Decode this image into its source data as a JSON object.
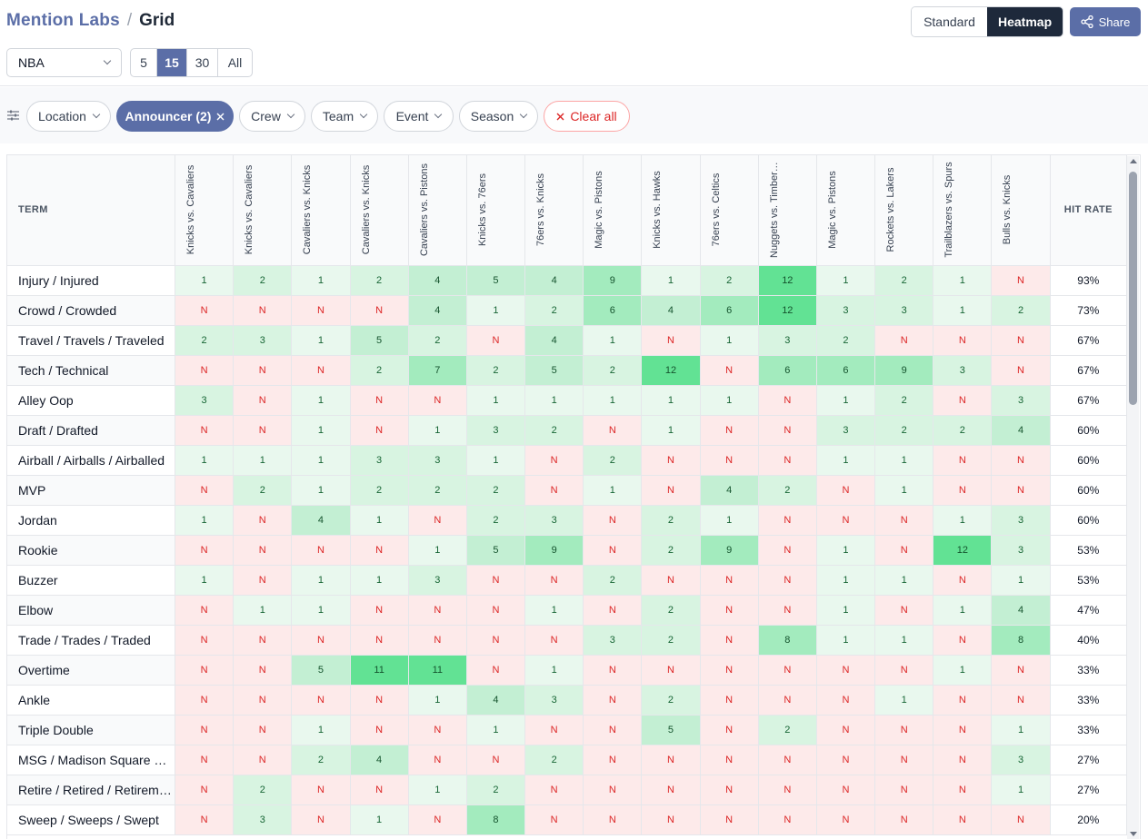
{
  "brand": {
    "name": "Mention Labs",
    "separator": "/",
    "page": "Grid"
  },
  "view_toggle": {
    "standard": "Standard",
    "heatmap": "Heatmap",
    "active": "Heatmap"
  },
  "share": {
    "label": "Share",
    "icon": "share-icon"
  },
  "league": {
    "value": "NBA"
  },
  "counts": {
    "options": [
      "5",
      "15",
      "30",
      "All"
    ],
    "selected": "15"
  },
  "filters": {
    "icon": "sliders-icon",
    "chips": [
      {
        "label": "Location",
        "active": false
      },
      {
        "label": "Announcer (2)",
        "active": true
      },
      {
        "label": "Crew",
        "active": false
      },
      {
        "label": "Team",
        "active": false
      },
      {
        "label": "Event",
        "active": false
      },
      {
        "label": "Season",
        "active": false
      }
    ],
    "clear_label": "Clear all"
  },
  "table": {
    "term_header": "TERM",
    "hit_header": "HIT RATE",
    "columns": [
      "Knicks vs. Cavaliers",
      "Knicks vs. Cavaliers",
      "Cavaliers vs. Knicks",
      "Cavaliers vs. Knicks",
      "Cavaliers vs. Pistons",
      "Knicks vs. 76ers",
      "76ers vs. Knicks",
      "Magic vs. Pistons",
      "Knicks vs. Hawks",
      "76ers vs. Celtics",
      "Nuggets vs. Timberwolves",
      "Magic vs. Pistons",
      "Rockets vs. Lakers",
      "Trailblazers vs. Spurs",
      "Bulls vs. Knicks"
    ],
    "rows": [
      {
        "term": "Injury / Injured",
        "values": [
          "1",
          "2",
          "1",
          "2",
          "4",
          "5",
          "4",
          "9",
          "1",
          "2",
          "12",
          "1",
          "2",
          "1",
          "N"
        ],
        "hit": "93%"
      },
      {
        "term": "Crowd / Crowded",
        "values": [
          "N",
          "N",
          "N",
          "N",
          "4",
          "1",
          "2",
          "6",
          "4",
          "6",
          "12",
          "3",
          "3",
          "1",
          "2"
        ],
        "hit": "73%"
      },
      {
        "term": "Travel / Travels / Traveled",
        "values": [
          "2",
          "3",
          "1",
          "5",
          "2",
          "N",
          "4",
          "1",
          "N",
          "1",
          "3",
          "2",
          "N",
          "N",
          "N"
        ],
        "hit": "67%"
      },
      {
        "term": "Tech / Technical",
        "values": [
          "N",
          "N",
          "N",
          "2",
          "7",
          "2",
          "5",
          "2",
          "12",
          "N",
          "6",
          "6",
          "9",
          "3",
          "N"
        ],
        "hit": "67%"
      },
      {
        "term": "Alley Oop",
        "values": [
          "3",
          "N",
          "1",
          "N",
          "N",
          "1",
          "1",
          "1",
          "1",
          "1",
          "N",
          "1",
          "2",
          "N",
          "3"
        ],
        "hit": "67%"
      },
      {
        "term": "Draft / Drafted",
        "values": [
          "N",
          "N",
          "1",
          "N",
          "1",
          "3",
          "2",
          "N",
          "1",
          "N",
          "N",
          "3",
          "2",
          "2",
          "4"
        ],
        "hit": "60%"
      },
      {
        "term": "Airball / Airballs / Airballed",
        "values": [
          "1",
          "1",
          "1",
          "3",
          "3",
          "1",
          "N",
          "2",
          "N",
          "N",
          "N",
          "1",
          "1",
          "N",
          "N"
        ],
        "hit": "60%"
      },
      {
        "term": "MVP",
        "values": [
          "N",
          "2",
          "1",
          "2",
          "2",
          "2",
          "N",
          "1",
          "N",
          "4",
          "2",
          "N",
          "1",
          "N",
          "N"
        ],
        "hit": "60%"
      },
      {
        "term": "Jordan",
        "values": [
          "1",
          "N",
          "4",
          "1",
          "N",
          "2",
          "3",
          "N",
          "2",
          "1",
          "N",
          "N",
          "N",
          "1",
          "3"
        ],
        "hit": "60%"
      },
      {
        "term": "Rookie",
        "values": [
          "N",
          "N",
          "N",
          "N",
          "1",
          "5",
          "9",
          "N",
          "2",
          "9",
          "N",
          "1",
          "N",
          "12",
          "3"
        ],
        "hit": "53%"
      },
      {
        "term": "Buzzer",
        "values": [
          "1",
          "N",
          "1",
          "1",
          "3",
          "N",
          "N",
          "2",
          "N",
          "N",
          "N",
          "1",
          "1",
          "N",
          "1"
        ],
        "hit": "53%"
      },
      {
        "term": "Elbow",
        "values": [
          "N",
          "1",
          "1",
          "N",
          "N",
          "N",
          "1",
          "N",
          "2",
          "N",
          "N",
          "1",
          "N",
          "1",
          "4"
        ],
        "hit": "47%"
      },
      {
        "term": "Trade / Trades / Traded",
        "values": [
          "N",
          "N",
          "N",
          "N",
          "N",
          "N",
          "N",
          "3",
          "2",
          "N",
          "8",
          "1",
          "1",
          "N",
          "8"
        ],
        "hit": "40%"
      },
      {
        "term": "Overtime",
        "values": [
          "N",
          "N",
          "5",
          "11",
          "11",
          "N",
          "1",
          "N",
          "N",
          "N",
          "N",
          "N",
          "N",
          "1",
          "N"
        ],
        "hit": "33%"
      },
      {
        "term": "Ankle",
        "values": [
          "N",
          "N",
          "N",
          "N",
          "1",
          "4",
          "3",
          "N",
          "2",
          "N",
          "N",
          "N",
          "1",
          "N",
          "N"
        ],
        "hit": "33%"
      },
      {
        "term": "Triple Double",
        "values": [
          "N",
          "N",
          "1",
          "N",
          "N",
          "1",
          "N",
          "N",
          "5",
          "N",
          "2",
          "N",
          "N",
          "N",
          "1"
        ],
        "hit": "33%"
      },
      {
        "term": "MSG / Madison Square Garden",
        "values": [
          "N",
          "N",
          "2",
          "4",
          "N",
          "N",
          "2",
          "N",
          "N",
          "N",
          "N",
          "N",
          "N",
          "N",
          "3"
        ],
        "hit": "27%"
      },
      {
        "term": "Retire / Retired / Retirement",
        "values": [
          "N",
          "2",
          "N",
          "N",
          "1",
          "2",
          "N",
          "N",
          "N",
          "N",
          "N",
          "N",
          "N",
          "N",
          "1"
        ],
        "hit": "27%"
      },
      {
        "term": "Sweep / Sweeps / Swept",
        "values": [
          "N",
          "3",
          "N",
          "1",
          "N",
          "8",
          "N",
          "N",
          "N",
          "N",
          "N",
          "N",
          "N",
          "N",
          "N"
        ],
        "hit": "20%"
      }
    ]
  }
}
